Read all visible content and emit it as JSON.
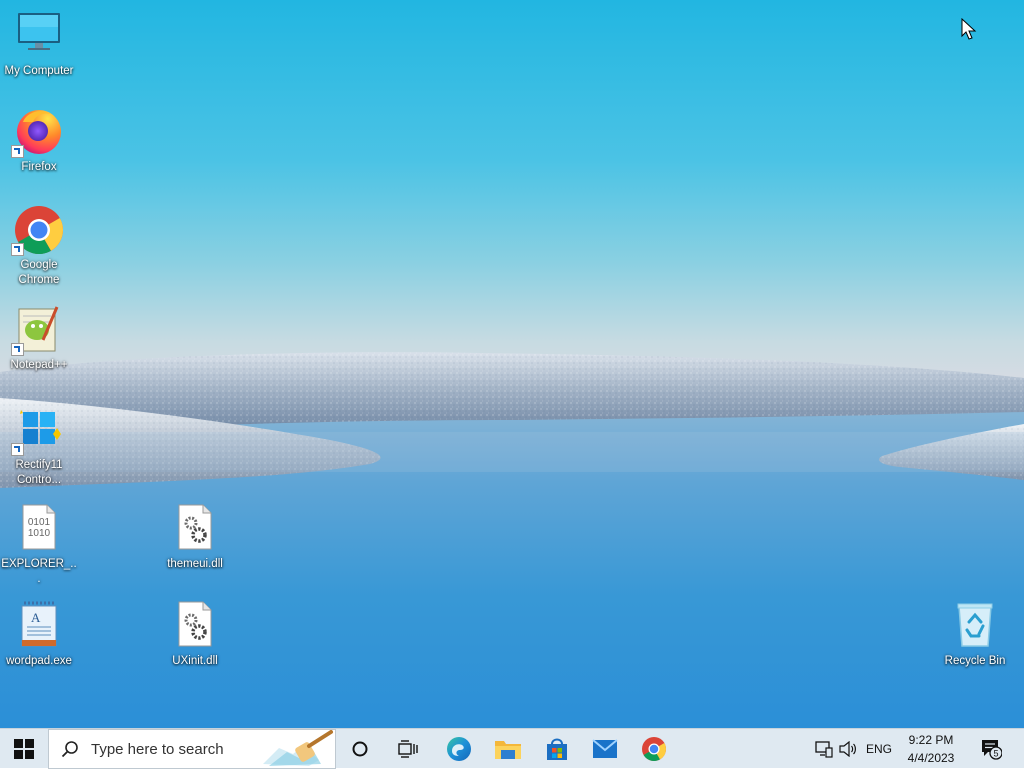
{
  "desktop": {
    "icons": [
      {
        "label": "My Computer"
      },
      {
        "label": "Firefox"
      },
      {
        "label": "Google Chrome"
      },
      {
        "label": "Notepad++"
      },
      {
        "label": "Rectify11 Contro..."
      },
      {
        "label": "EXPLORER_..."
      },
      {
        "label": "wordpad.exe"
      },
      {
        "label": "themeui.dll"
      },
      {
        "label": "UXinit.dll"
      },
      {
        "label": "Recycle Bin"
      }
    ],
    "binary_icon_text": [
      "0101",
      "1010"
    ]
  },
  "taskbar": {
    "search_placeholder": "Type here to search",
    "pinned": [
      "Cortana",
      "Task View",
      "Microsoft Edge",
      "File Explorer",
      "Microsoft Store",
      "Mail",
      "Google Chrome"
    ],
    "tray": {
      "language": "ENG",
      "time": "9:22 PM",
      "date": "4/4/2023",
      "notification_count": "5"
    }
  },
  "colors": {
    "sky_top": "#24b8e2",
    "sky_mid": "#9fd4e3",
    "water": "#3a9fd6",
    "taskbar": "#dfe9f1"
  }
}
